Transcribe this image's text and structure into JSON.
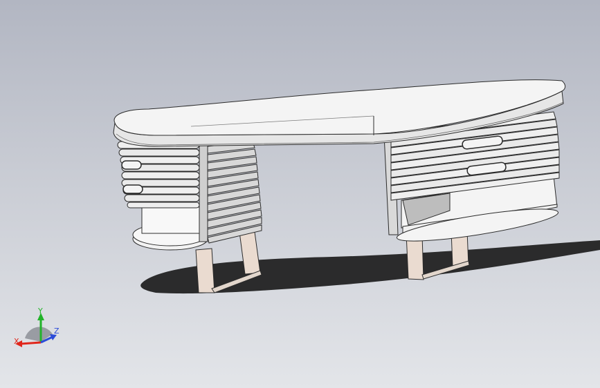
{
  "viewport": {
    "background_top": "#b2b6c2",
    "background_bottom": "#e3e5e9"
  },
  "model": {
    "type": "3d-model-desk",
    "colors": {
      "body": "#ededed",
      "edge": "#2b2b2b",
      "legs": "#eadbd0",
      "shadow": "#1c1c1c",
      "inner": "#c7c7c7"
    }
  },
  "triad": {
    "x_label": "X",
    "y_label": "Y",
    "z_label": "Z",
    "x_color": "#e0261b",
    "y_color": "#22b32a",
    "z_color": "#2b4bd8"
  }
}
